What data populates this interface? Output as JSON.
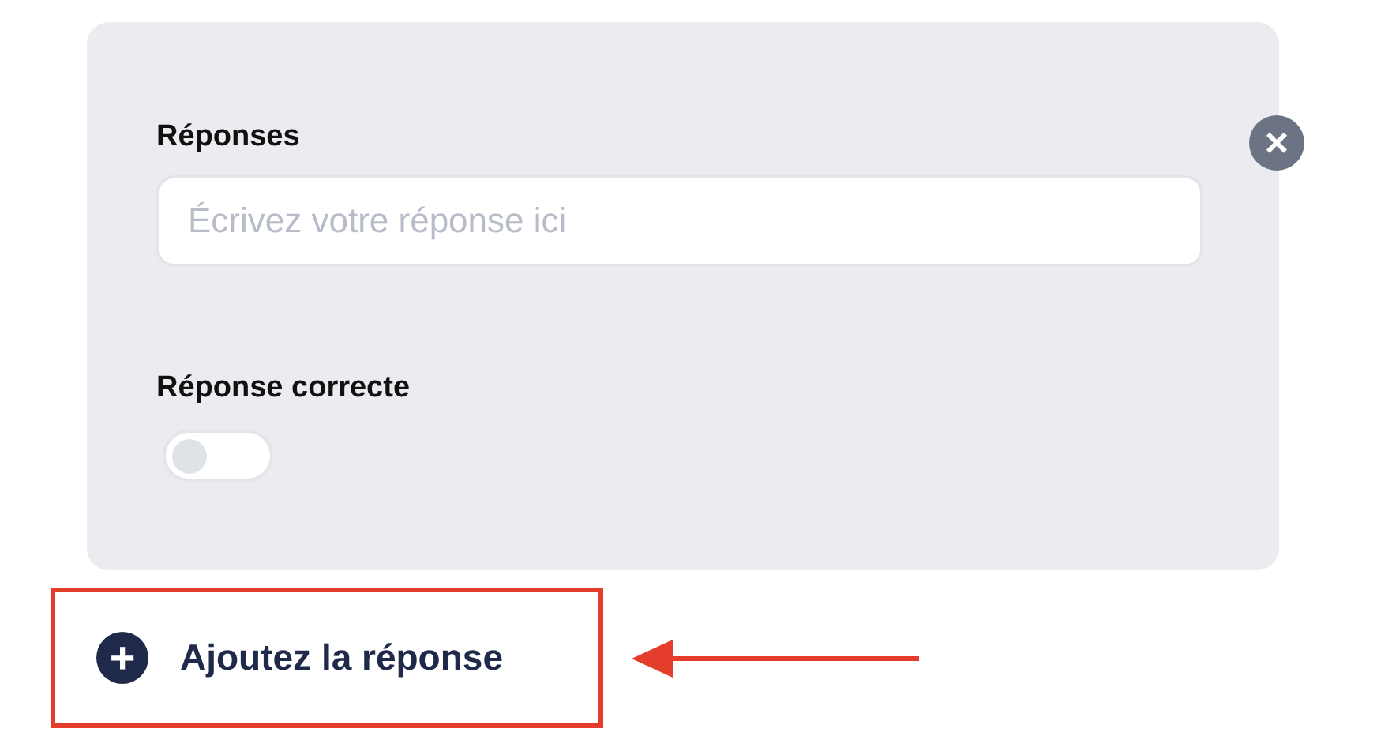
{
  "answer_card": {
    "answers_label": "Réponses",
    "answer_field": {
      "placeholder": "Écrivez votre réponse ici"
    },
    "remove_button": "×",
    "correct_label": "Réponse correcte",
    "correct_toggle": {
      "on": false
    }
  },
  "add_answer": {
    "icon": "+",
    "label": "Ajoutez la réponse"
  }
}
